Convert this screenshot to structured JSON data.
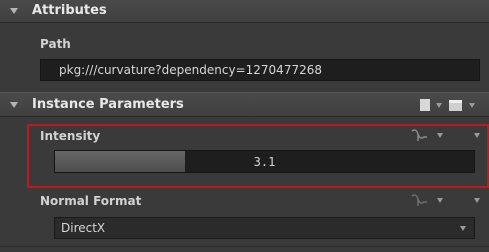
{
  "attributes": {
    "title": "Attributes",
    "path_label": "Path",
    "path_value": "pkg:///curvature?dependency=1270477268"
  },
  "instance_parameters": {
    "title": "Instance Parameters",
    "intensity": {
      "label": "Intensity",
      "value": "3.1",
      "slider_fraction": 0.31
    },
    "normal_format": {
      "label": "Normal Format",
      "selected": "DirectX"
    }
  },
  "colors": {
    "panel_bg": "#3a3a3a",
    "highlight_border": "#c0191b",
    "field_bg": "#1e1e1e",
    "slider_fill": "#5a5a5a"
  },
  "icons": [
    "collapse-arrow-icon",
    "preset-icon",
    "connect-icon",
    "dropdown-arrow-icon"
  ]
}
